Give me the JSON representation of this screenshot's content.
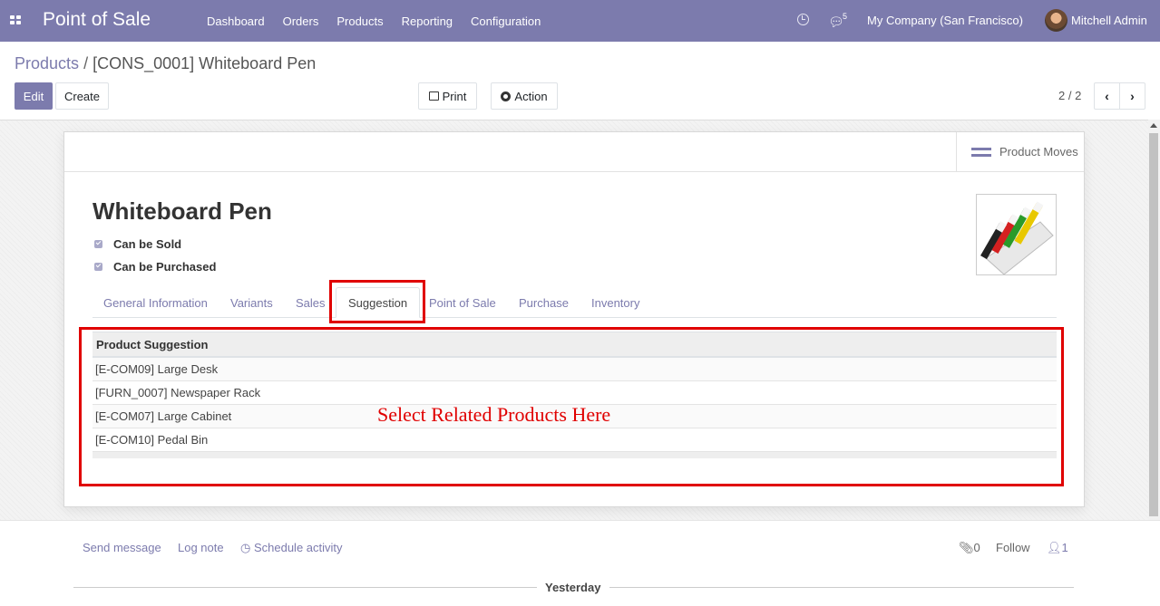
{
  "navbar": {
    "app_title": "Point of Sale",
    "menu": [
      "Dashboard",
      "Orders",
      "Products",
      "Reporting",
      "Configuration"
    ],
    "messages_count": "5",
    "company": "My Company (San Francisco)",
    "user": "Mitchell Admin"
  },
  "control": {
    "breadcrumb_parent": "Products",
    "breadcrumb_separator": "/",
    "breadcrumb_current": "[CONS_0001] Whiteboard Pen",
    "edit_label": "Edit",
    "create_label": "Create",
    "print_label": "Print",
    "action_label": "Action",
    "pager": "2 / 2"
  },
  "form": {
    "stat_button": "Product Moves",
    "product_name": "Whiteboard Pen",
    "can_be_sold": "Can be Sold",
    "can_be_purchased": "Can be Purchased",
    "tabs": [
      "General Information",
      "Variants",
      "Sales",
      "Suggestion",
      "Point of Sale",
      "Purchase",
      "Inventory"
    ],
    "active_tab": "Suggestion",
    "table_header": "Product Suggestion",
    "rows": [
      "[E-COM09] Large Desk",
      "[FURN_0007] Newspaper Rack",
      "[E-COM07] Large Cabinet",
      "[E-COM10] Pedal Bin"
    ]
  },
  "annotation": {
    "text": "Select Related Products Here",
    "color": "#e00000"
  },
  "chatter": {
    "send_message": "Send message",
    "log_note": "Log note",
    "schedule_activity": "Schedule activity",
    "attachments": "0",
    "follow": "Follow",
    "followers": "1",
    "date_separator": "Yesterday"
  },
  "colors": {
    "brand": "#7c7bad"
  }
}
